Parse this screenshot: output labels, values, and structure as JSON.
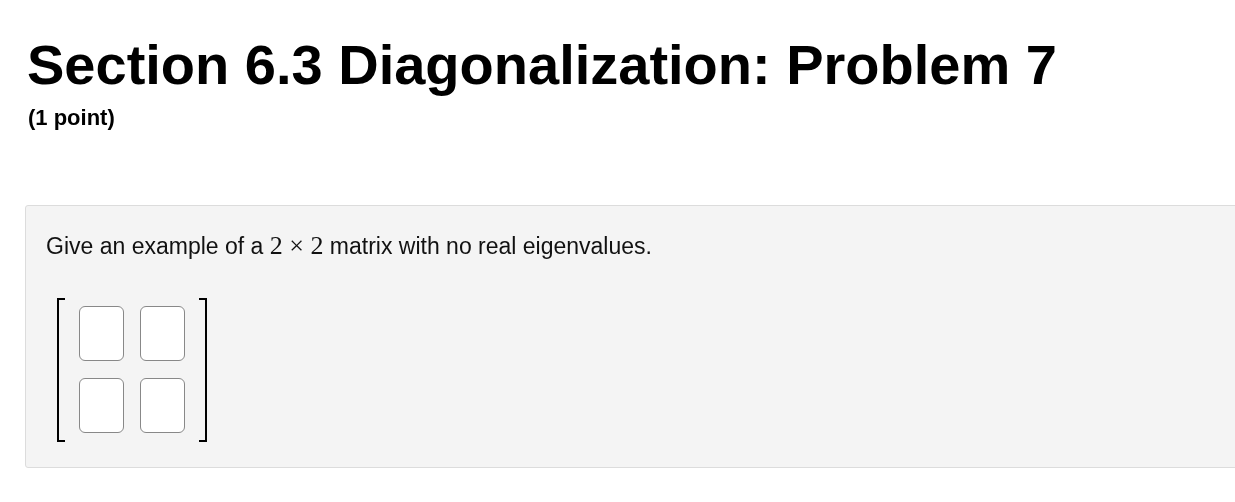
{
  "title": "Section 6.3 Diagonalization: Problem 7",
  "points": "(1 point)",
  "problem": {
    "prompt": [
      {
        "kind": "text",
        "text": "Give an example of a "
      },
      {
        "kind": "math",
        "text": "2 × 2"
      },
      {
        "kind": "text",
        "text": " matrix with no real eigenvalues."
      }
    ],
    "answer_matrix": {
      "rows": [
        {
          "cells": [
            {
              "kind": "blank"
            },
            {
              "kind": "blank"
            }
          ]
        },
        {
          "cells": [
            {
              "kind": "blank"
            },
            {
              "kind": "blank"
            }
          ]
        }
      ]
    }
  }
}
